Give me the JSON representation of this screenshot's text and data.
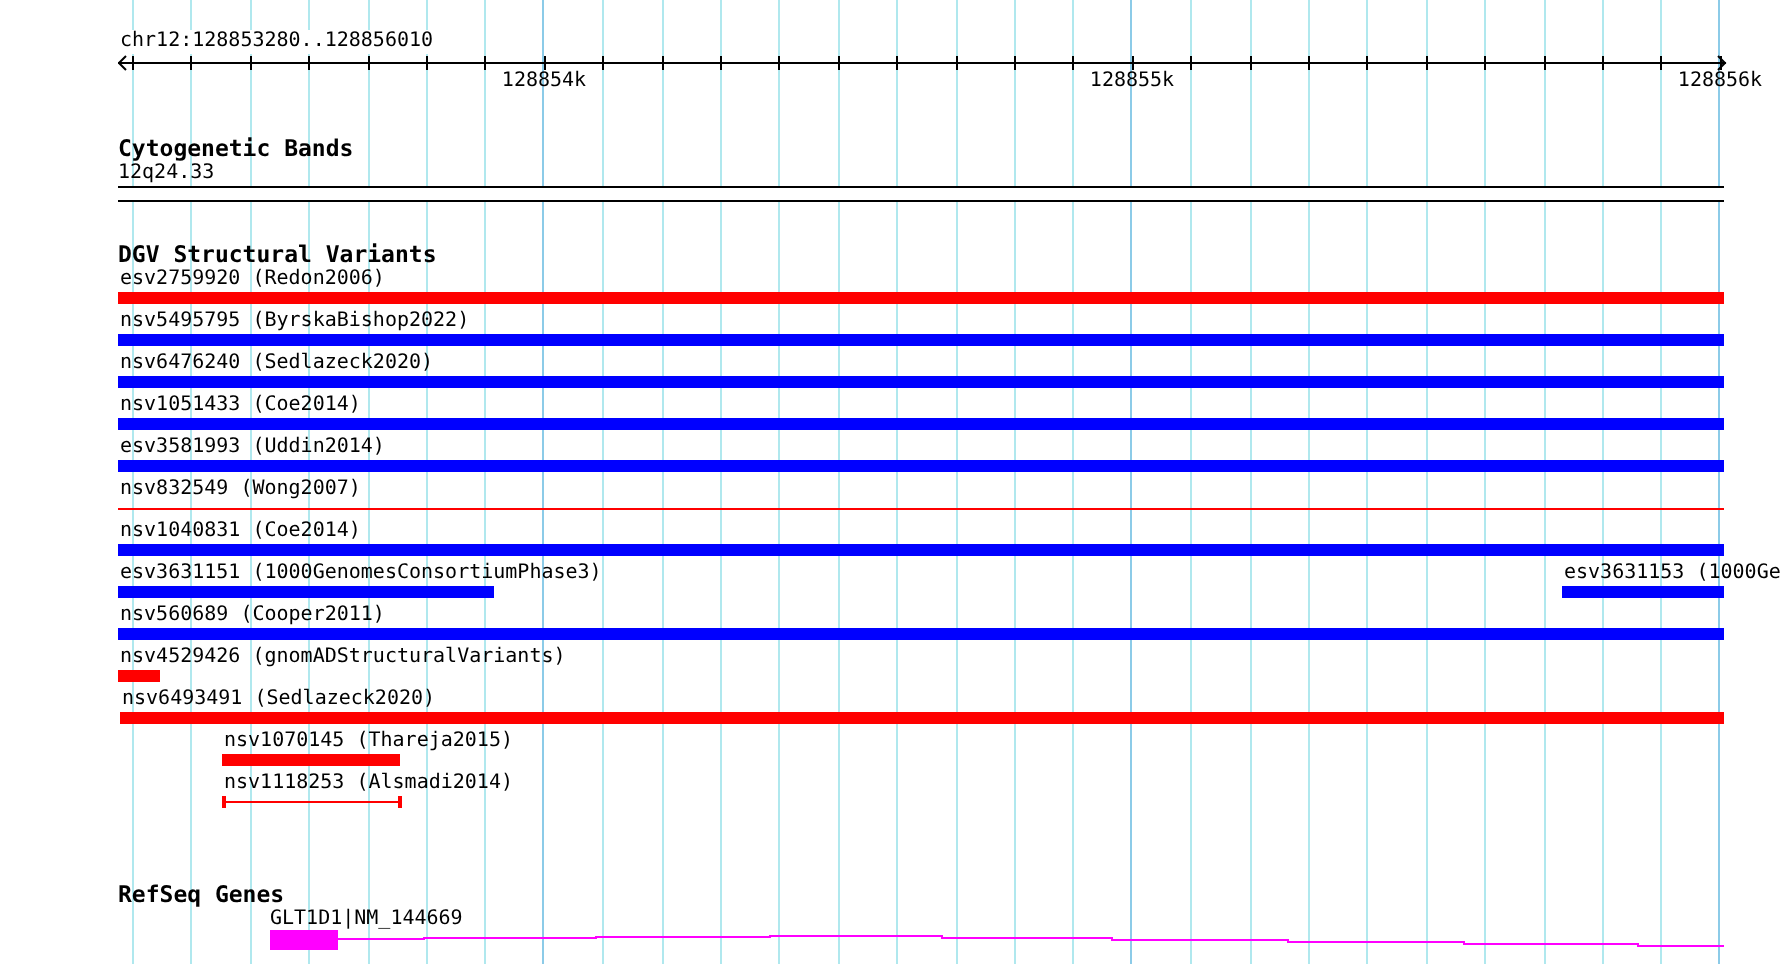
{
  "ruler": {
    "region": "chr12:128853280..128856010",
    "ticks": [
      "128854k",
      "128855k",
      "128856k"
    ]
  },
  "cytobands": {
    "title": "Cytogenetic Bands",
    "band": "12q24.33"
  },
  "dgv": {
    "title": "DGV Structural Variants",
    "rows": [
      {
        "features": [
          {
            "label": "esv2759920 (Redon2006)",
            "kind": "bar",
            "color": "#ff0000"
          }
        ]
      },
      {
        "features": [
          {
            "label": "nsv5495795 (ByrskaBishop2022)",
            "kind": "bar",
            "color": "#0000ff"
          }
        ]
      },
      {
        "features": [
          {
            "label": "nsv6476240 (Sedlazeck2020)",
            "kind": "bar",
            "color": "#0000ff"
          }
        ]
      },
      {
        "features": [
          {
            "label": "nsv1051433 (Coe2014)",
            "kind": "bar",
            "color": "#0000ff"
          }
        ]
      },
      {
        "features": [
          {
            "label": "esv3581993 (Uddin2014)",
            "kind": "bar",
            "color": "#0000ff"
          }
        ]
      },
      {
        "features": [
          {
            "label": "nsv832549 (Wong2007)",
            "kind": "line",
            "color": "#ff0000"
          }
        ]
      },
      {
        "features": [
          {
            "label": "nsv1040831 (Coe2014)",
            "kind": "bar",
            "color": "#0000ff"
          }
        ]
      },
      {
        "features": [
          {
            "label": "esv3631151 (1000GenomesConsortiumPhase3)",
            "kind": "bar",
            "color": "#0000ff"
          },
          {
            "label": "esv3631153 (1000Ge",
            "kind": "bar",
            "color": "#0000ff"
          }
        ]
      },
      {
        "features": [
          {
            "label": "nsv560689 (Cooper2011)",
            "kind": "bar",
            "color": "#0000ff"
          }
        ]
      },
      {
        "features": [
          {
            "label": "nsv4529426 (gnomADStructuralVariants)",
            "kind": "bar",
            "color": "#ff0000"
          }
        ]
      },
      {
        "features": [
          {
            "label": "nsv6493491 (Sedlazeck2020)",
            "kind": "bar",
            "color": "#ff0000"
          }
        ]
      },
      {
        "features": [
          {
            "label": "nsv1070145 (Thareja2015)",
            "kind": "bar",
            "color": "#ff0000"
          }
        ]
      },
      {
        "features": [
          {
            "label": "nsv1118253 (Alsmadi2014)",
            "kind": "interval",
            "color": "#ff0000"
          }
        ]
      }
    ]
  },
  "refseq": {
    "title": "RefSeq Genes",
    "genes": [
      {
        "label": "GLT1D1|NM_144669"
      }
    ]
  }
}
